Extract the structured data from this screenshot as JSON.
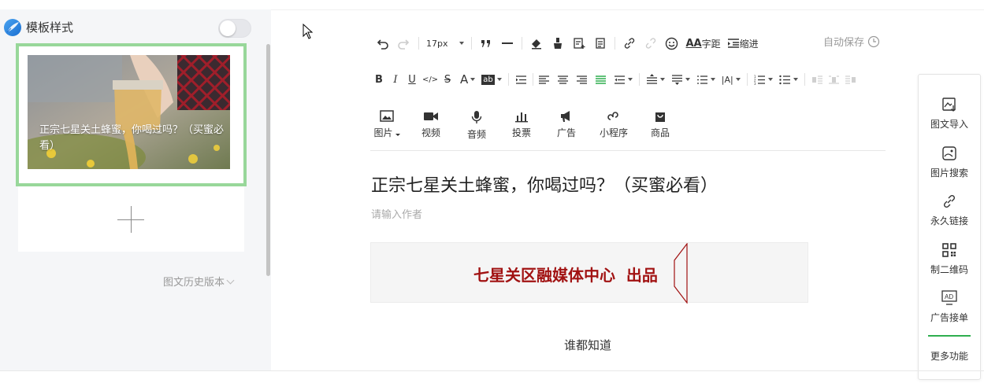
{
  "left_panel": {
    "title": "模板样式",
    "toggle_on": false,
    "article_title": "正宗七星关土蜂蜜，你喝过吗？（买蜜必看）",
    "history_label": "图文历史版本"
  },
  "toolbar": {
    "font_size": "17px",
    "letter_spacing_label": "字距",
    "indent_label": "缩进",
    "autosave_label": "自动保存"
  },
  "insert": [
    {
      "label": "图片",
      "icon": "image-icon"
    },
    {
      "label": "视频",
      "icon": "video-icon"
    },
    {
      "label": "音频",
      "icon": "microphone-icon"
    },
    {
      "label": "投票",
      "icon": "vote-icon"
    },
    {
      "label": "广告",
      "icon": "megaphone-icon"
    },
    {
      "label": "小程序",
      "icon": "mini-program-icon"
    },
    {
      "label": "商品",
      "icon": "shopping-bag-icon"
    }
  ],
  "editor": {
    "title": "正宗七星关土蜂蜜，你喝过吗？（买蜜必看）",
    "author_placeholder": "请输入作者",
    "banner_text": "七星关区融媒体中心  出品",
    "body_text": "谁都知道"
  },
  "right_sidebar": [
    {
      "label": "图文导入",
      "icon": "import-icon"
    },
    {
      "label": "图片搜索",
      "icon": "image-search-icon"
    },
    {
      "label": "永久链接",
      "icon": "link-icon"
    },
    {
      "label": "制二维码",
      "icon": "qr-code-icon"
    },
    {
      "label": "广告接单",
      "icon": "ad-icon"
    },
    {
      "label": "更多功能",
      "icon": ""
    }
  ],
  "colors": {
    "accent_green": "#2fae4f",
    "selection_border": "#98d79a",
    "banner_red": "#a11212"
  }
}
